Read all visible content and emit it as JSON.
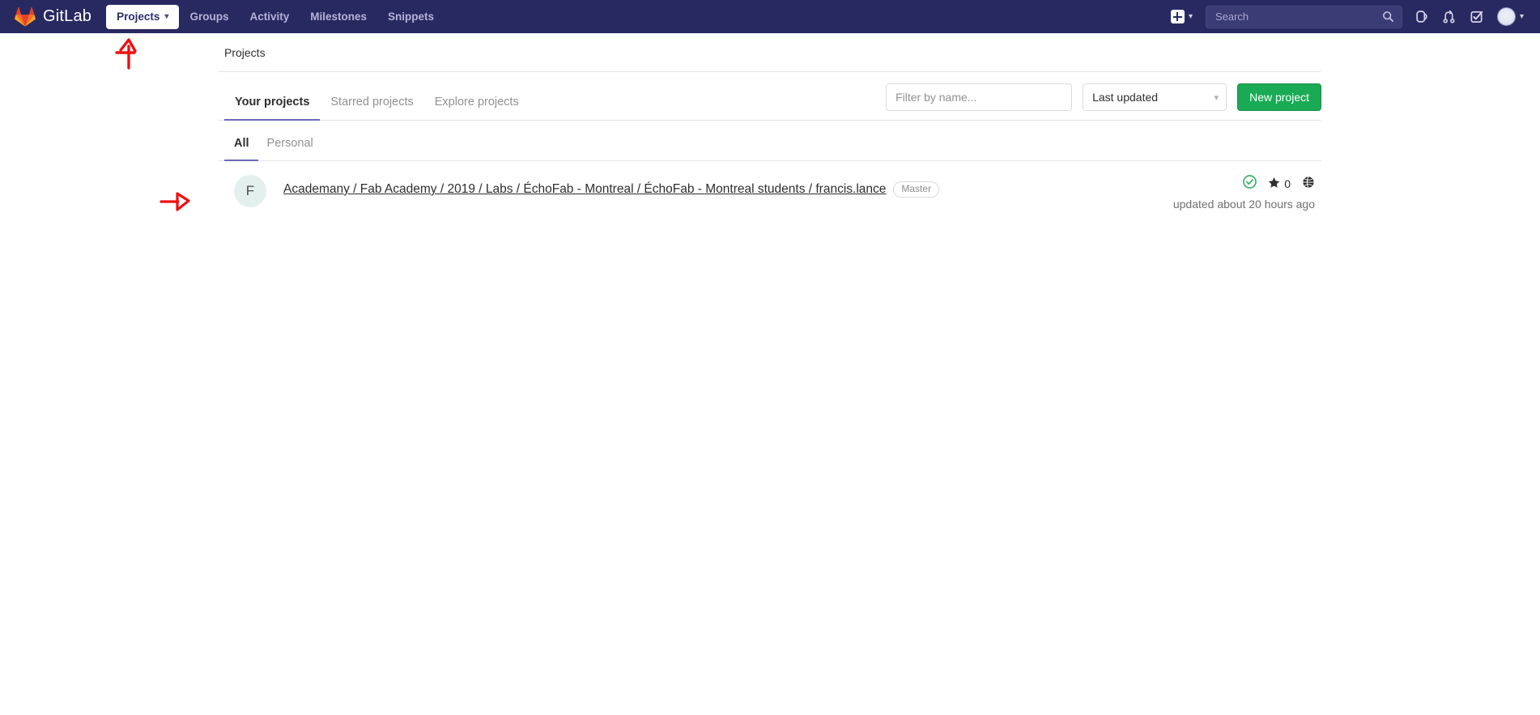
{
  "navbar": {
    "brand_name": "GitLab",
    "brand_icon": "gitlab-tanuki-logo",
    "links": [
      {
        "label": "Projects",
        "icon": "chevron-down-icon",
        "active": true
      },
      {
        "label": "Groups",
        "active": false
      },
      {
        "label": "Activity",
        "active": false
      },
      {
        "label": "Milestones",
        "active": false
      },
      {
        "label": "Snippets",
        "active": false
      }
    ],
    "create_new": {
      "icon": "plus-square-icon",
      "caret": "chevron-down-icon"
    },
    "search": {
      "placeholder": "Search",
      "value": "",
      "icon": "search-icon"
    },
    "icons": [
      {
        "name": "issues-icon"
      },
      {
        "name": "merge-requests-icon"
      },
      {
        "name": "todos-icon"
      }
    ],
    "user": {
      "avatar": "user-avatar",
      "caret": "chevron-down-icon"
    },
    "bg_color": "#292961"
  },
  "breadcrumb": {
    "text": "Projects"
  },
  "tabs": [
    {
      "label": "Your projects",
      "active": true
    },
    {
      "label": "Starred projects",
      "active": false
    },
    {
      "label": "Explore projects",
      "active": false
    }
  ],
  "controls": {
    "filter": {
      "placeholder": "Filter by name...",
      "value": ""
    },
    "sort": {
      "selected": "Last updated",
      "caret": "chevron-down-icon"
    },
    "new_project": {
      "label": "New project",
      "color": "#1aaa55"
    }
  },
  "subtabs": [
    {
      "label": "All",
      "active": true
    },
    {
      "label": "Personal",
      "active": false
    }
  ],
  "projects": [
    {
      "avatar_letter": "F",
      "avatar_bg": "#e4f0ee",
      "path": "Academany / Fab Academy / 2019 / Labs / ÉchoFab - Montreal / ÉchoFab - Montreal students / francis.lance",
      "role_badge": "Master",
      "ci_status": {
        "name": "pipeline-passed-icon",
        "color": "#31af64"
      },
      "stars": {
        "icon": "star-icon",
        "count": "0"
      },
      "visibility": {
        "icon": "globe-icon",
        "title": "Public"
      },
      "updated": "updated about 20 hours ago"
    }
  ],
  "annotations": {
    "color": "#ee1111",
    "items": [
      {
        "name": "arrow-up-annotation",
        "points_to": "Projects nav item"
      },
      {
        "name": "arrow-right-annotation",
        "points_to": "project row"
      }
    ]
  }
}
